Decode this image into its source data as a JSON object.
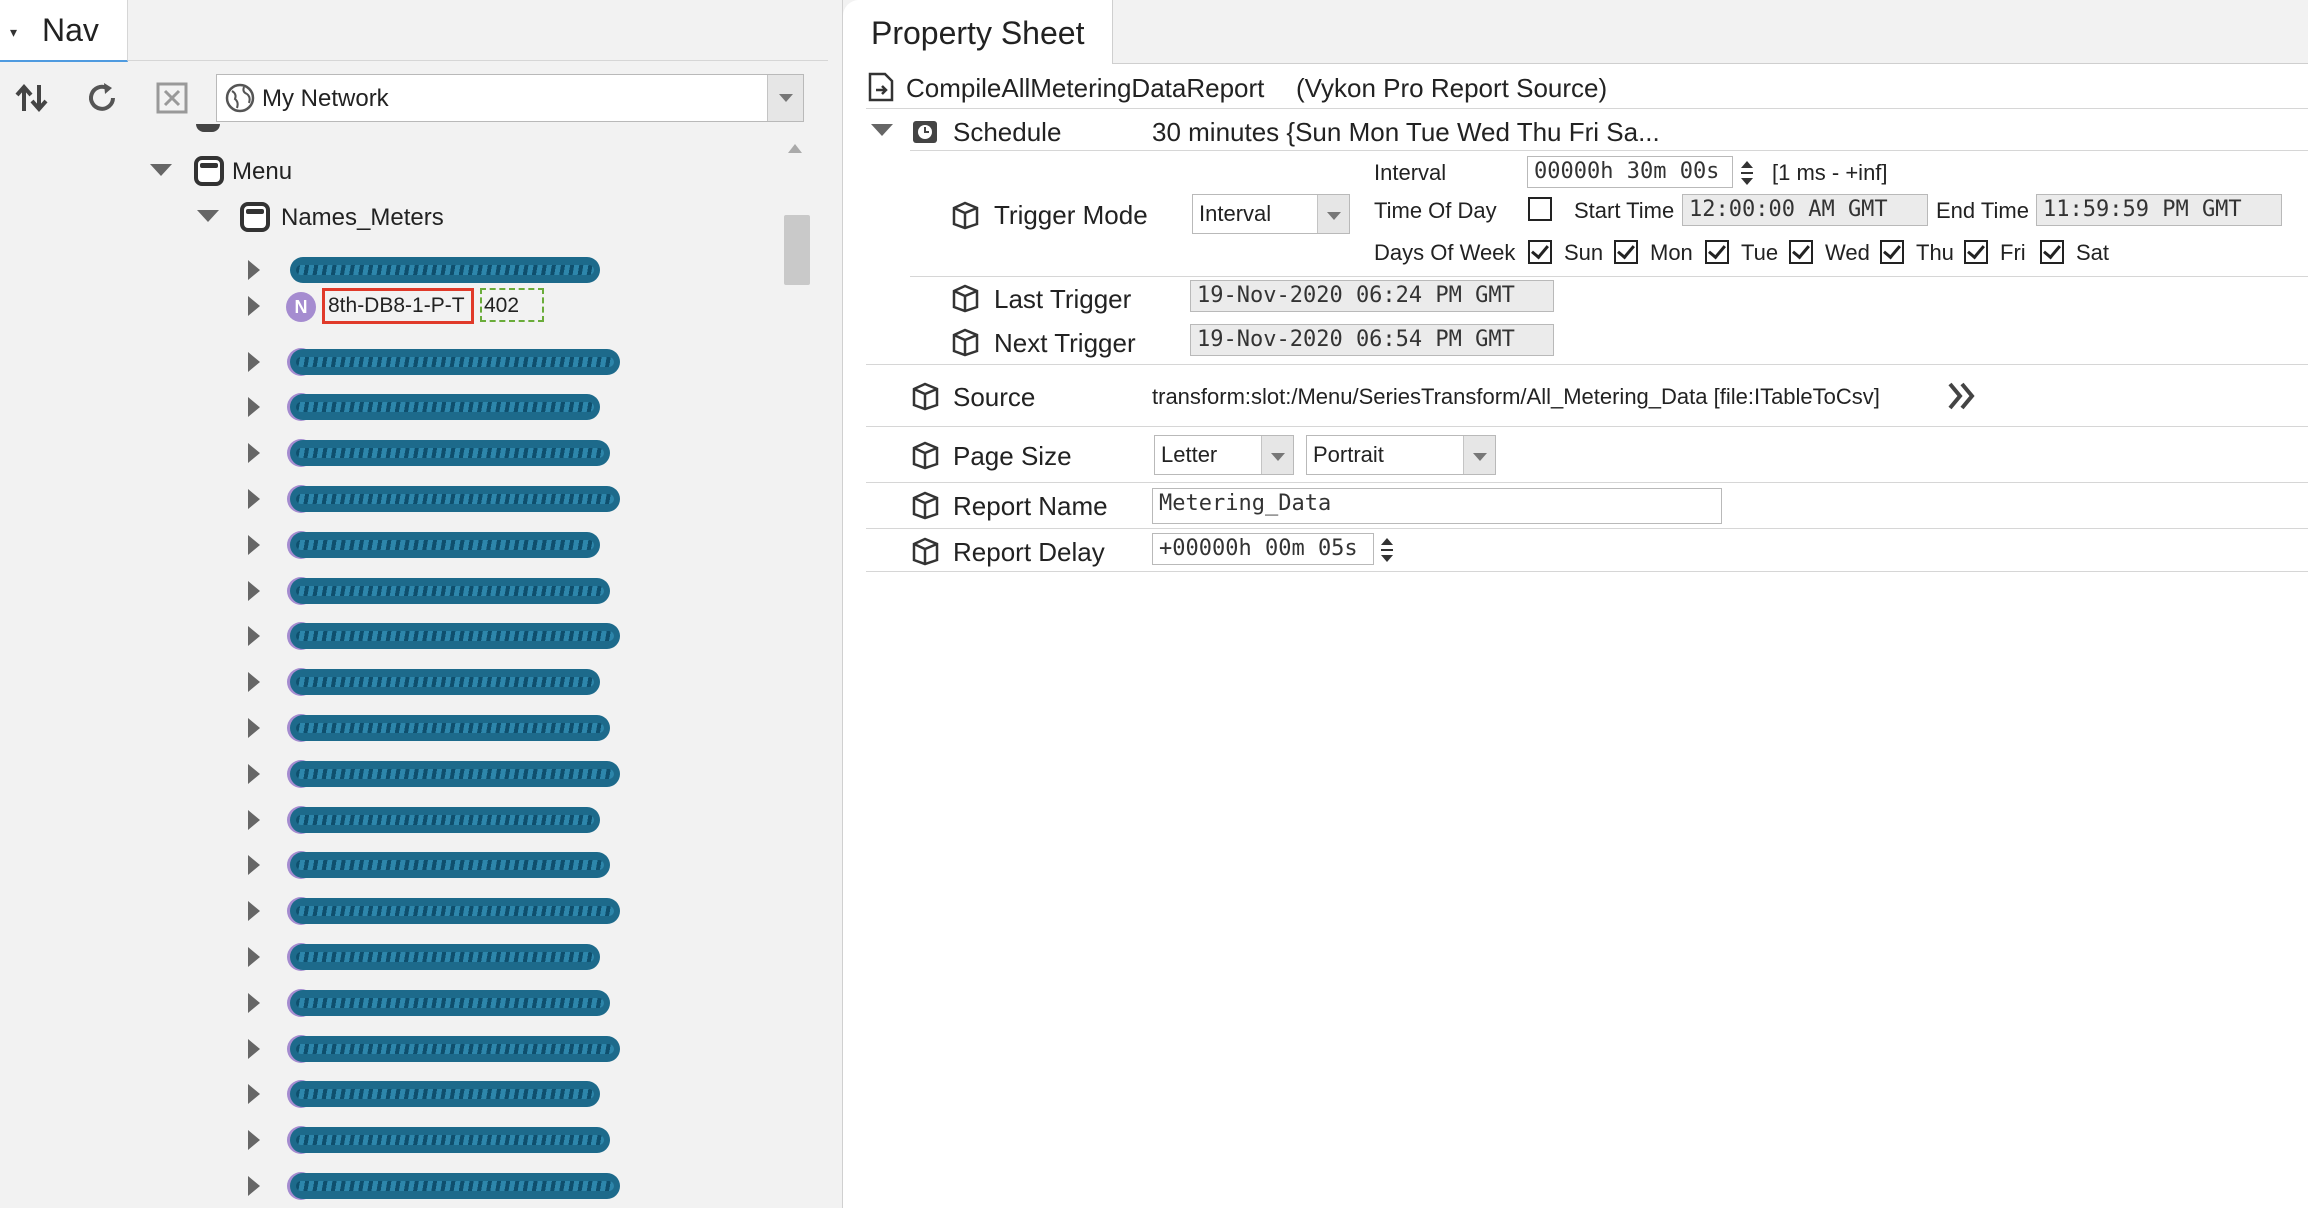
{
  "nav": {
    "tab_label": "Nav",
    "combo_value": "My Network",
    "tree": {
      "menu_label": "Menu",
      "names_meters_label": "Names_Meters",
      "highlighted_item": {
        "name": "8th-DB8-1-P-T",
        "value": "402"
      },
      "redacted_rows": 20
    }
  },
  "property_sheet": {
    "tab_label": "Property Sheet",
    "component_title": "CompileAllMeteringDataReport",
    "component_type": "(Vykon Pro Report Source)",
    "schedule": {
      "label": "Schedule",
      "summary": "30 minutes {Sun Mon Tue Wed Thu Fri Sa...",
      "trigger_mode_label": "Trigger Mode",
      "trigger_mode_value": "Interval",
      "interval_label": "Interval",
      "interval_value": "00000h 30m 00s",
      "interval_range": "[1 ms - +inf]",
      "time_of_day_label": "Time Of Day",
      "start_time_label": "Start Time",
      "start_time_value": "12:00:00 AM GMT",
      "end_time_label": "End Time",
      "end_time_value": "11:59:59 PM GMT",
      "days_of_week_label": "Days Of Week",
      "days": [
        "Sun",
        "Mon",
        "Tue",
        "Wed",
        "Thu",
        "Fri",
        "Sat"
      ],
      "last_trigger_label": "Last Trigger",
      "last_trigger_value": "19-Nov-2020 06:24 PM GMT",
      "next_trigger_label": "Next Trigger",
      "next_trigger_value": "19-Nov-2020 06:54 PM GMT"
    },
    "source_label": "Source",
    "source_value": "transform:slot:/Menu/SeriesTransform/All_Metering_Data [file:ITableToCsv]",
    "page_size_label": "Page Size",
    "page_size_value": "Letter",
    "orientation_value": "Portrait",
    "report_name_label": "Report Name",
    "report_name_value": "Metering_Data",
    "report_delay_label": "Report Delay",
    "report_delay_value": "+00000h 00m 05s"
  }
}
